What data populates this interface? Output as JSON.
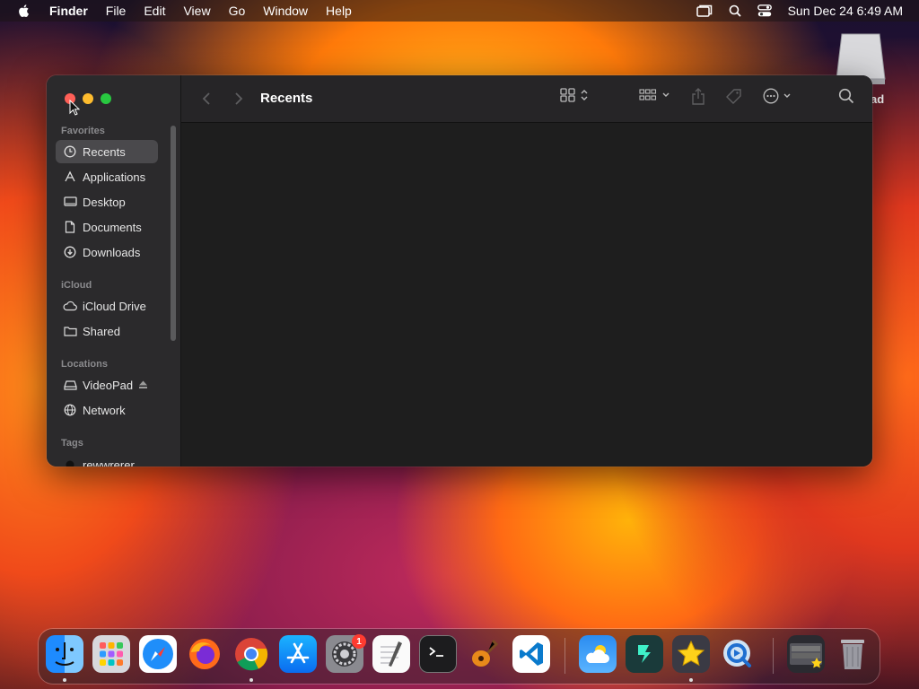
{
  "menubar": {
    "app_name": "Finder",
    "items": [
      "File",
      "Edit",
      "View",
      "Go",
      "Window",
      "Help"
    ],
    "datetime": "Sun Dec 24  6:49 AM"
  },
  "desktop": {
    "drive_label": "ad"
  },
  "window": {
    "title": "Recents",
    "sidebar": {
      "favorites_label": "Favorites",
      "favorites": [
        "Recents",
        "Applications",
        "Desktop",
        "Documents",
        "Downloads"
      ],
      "icloud_label": "iCloud",
      "icloud": [
        "iCloud Drive",
        "Shared"
      ],
      "locations_label": "Locations",
      "locations": [
        "VideoPad",
        "Network"
      ],
      "tags_label": "Tags",
      "tags": [
        "rewwrerer"
      ]
    }
  },
  "dock": {
    "apps": [
      "finder",
      "launchpad",
      "safari",
      "firefox",
      "chrome",
      "app-store",
      "system-settings",
      "textedit",
      "terminal",
      "garageband",
      "vscode",
      "weather",
      "filmora",
      "imovie-star",
      "quicktime",
      "screenshot-folder",
      "trash"
    ],
    "settings_badge": "1"
  },
  "colors": {
    "sidebar_bg": "#2b2a2c",
    "selected_bg": "#4a494c",
    "content_bg": "#1e1e1e",
    "close": "#ff5f57",
    "minimize": "#febc2e",
    "zoom": "#28c840"
  }
}
